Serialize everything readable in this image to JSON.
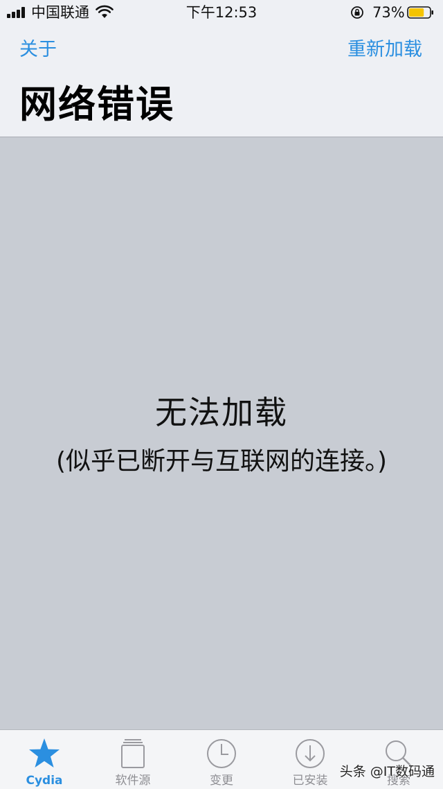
{
  "status_bar": {
    "carrier": "中国联通",
    "time": "下午12:53",
    "battery_percent": "73%",
    "battery_level": 0.73,
    "icons": [
      "signal-icon",
      "wifi-icon",
      "rotation-lock-icon",
      "battery-icon"
    ]
  },
  "nav": {
    "left_label": "关于",
    "right_label": "重新加载",
    "title": "网络错误"
  },
  "content": {
    "error_title": "无法加载",
    "error_detail": "(似乎已断开与互联网的连接。)"
  },
  "tabs": [
    {
      "label": "Cydia",
      "icon": "star-icon",
      "active": true
    },
    {
      "label": "软件源",
      "icon": "sources-icon",
      "active": false
    },
    {
      "label": "变更",
      "icon": "clock-icon",
      "active": false
    },
    {
      "label": "已安装",
      "icon": "download-icon",
      "active": false
    },
    {
      "label": "搜索",
      "icon": "search-icon",
      "active": false
    }
  ],
  "watermark": "头条 @IT数码通",
  "colors": {
    "accent": "#2b8fe0",
    "background": "#c8ccd3",
    "bar_background": "#eef0f4",
    "battery_fill": "#f5c400"
  }
}
